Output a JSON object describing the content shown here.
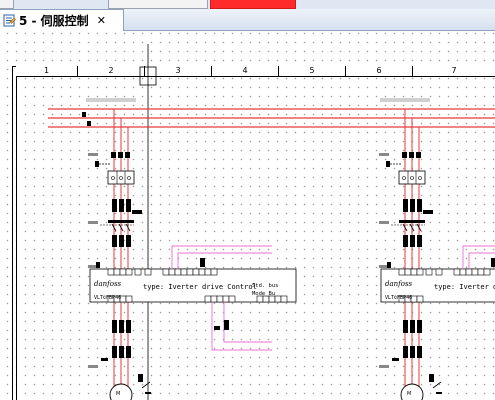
{
  "tab": {
    "label": "5 - 伺服控制",
    "close_glyph": "✕",
    "icon": "schematic-page-icon"
  },
  "ruler": {
    "columns": [
      "1",
      "2",
      "3",
      "4",
      "5",
      "6",
      "7"
    ]
  },
  "drive": {
    "brand": "danfoss",
    "type_text": "type: Iverter drive Control",
    "type_text_right": "type: Iverter dri",
    "bus_label": "Std. bus",
    "mode_label": "Mode_Bu",
    "model_text": "VLT©FBP46"
  },
  "colors": {
    "power_line": "#e8393b",
    "signal_line": "#ee6fd6",
    "frame": "#000000",
    "tab_bar": "#d6e0ee"
  }
}
